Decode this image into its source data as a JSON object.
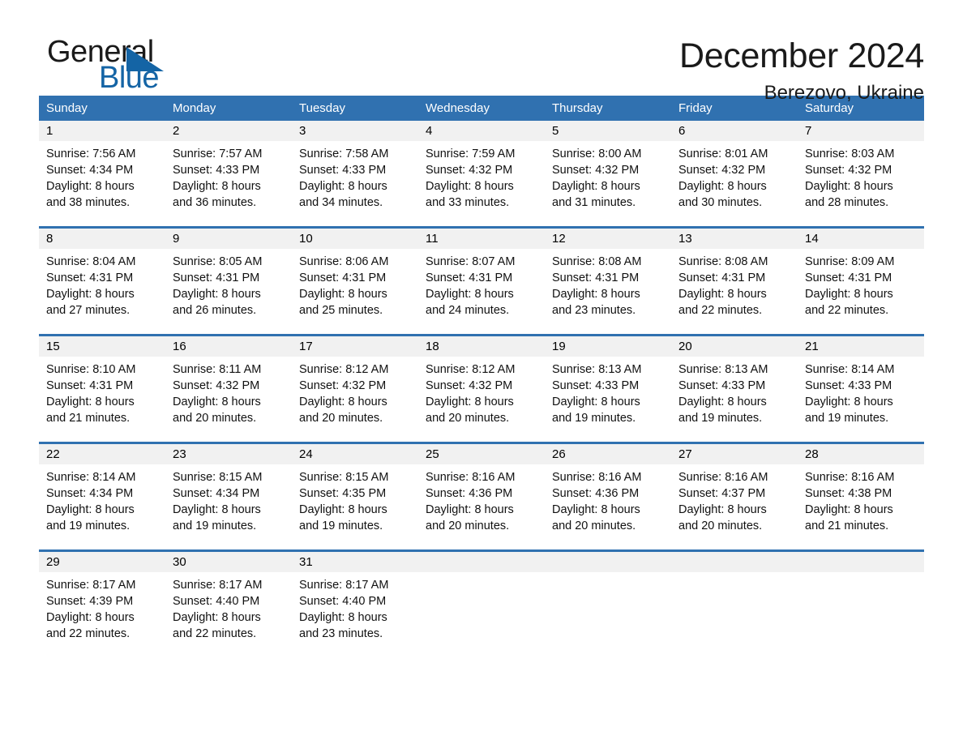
{
  "brand": {
    "name_part1": "General",
    "name_part2": "Blue",
    "triangle_color": "#1464a5",
    "text_color": "#1a1a1a"
  },
  "header": {
    "month_title": "December 2024",
    "location": "Berezovo, Ukraine"
  },
  "colors": {
    "header_blue": "#3071b0",
    "daynum_strip": "#f1f1f1",
    "page_background": "#ffffff"
  },
  "calendar": {
    "weekdays": [
      "Sunday",
      "Monday",
      "Tuesday",
      "Wednesday",
      "Thursday",
      "Friday",
      "Saturday"
    ],
    "weeks": [
      {
        "days": [
          {
            "num": "1",
            "lines": [
              "Sunrise: 7:56 AM",
              "Sunset: 4:34 PM",
              "Daylight: 8 hours",
              "and 38 minutes."
            ]
          },
          {
            "num": "2",
            "lines": [
              "Sunrise: 7:57 AM",
              "Sunset: 4:33 PM",
              "Daylight: 8 hours",
              "and 36 minutes."
            ]
          },
          {
            "num": "3",
            "lines": [
              "Sunrise: 7:58 AM",
              "Sunset: 4:33 PM",
              "Daylight: 8 hours",
              "and 34 minutes."
            ]
          },
          {
            "num": "4",
            "lines": [
              "Sunrise: 7:59 AM",
              "Sunset: 4:32 PM",
              "Daylight: 8 hours",
              "and 33 minutes."
            ]
          },
          {
            "num": "5",
            "lines": [
              "Sunrise: 8:00 AM",
              "Sunset: 4:32 PM",
              "Daylight: 8 hours",
              "and 31 minutes."
            ]
          },
          {
            "num": "6",
            "lines": [
              "Sunrise: 8:01 AM",
              "Sunset: 4:32 PM",
              "Daylight: 8 hours",
              "and 30 minutes."
            ]
          },
          {
            "num": "7",
            "lines": [
              "Sunrise: 8:03 AM",
              "Sunset: 4:32 PM",
              "Daylight: 8 hours",
              "and 28 minutes."
            ]
          }
        ]
      },
      {
        "days": [
          {
            "num": "8",
            "lines": [
              "Sunrise: 8:04 AM",
              "Sunset: 4:31 PM",
              "Daylight: 8 hours",
              "and 27 minutes."
            ]
          },
          {
            "num": "9",
            "lines": [
              "Sunrise: 8:05 AM",
              "Sunset: 4:31 PM",
              "Daylight: 8 hours",
              "and 26 minutes."
            ]
          },
          {
            "num": "10",
            "lines": [
              "Sunrise: 8:06 AM",
              "Sunset: 4:31 PM",
              "Daylight: 8 hours",
              "and 25 minutes."
            ]
          },
          {
            "num": "11",
            "lines": [
              "Sunrise: 8:07 AM",
              "Sunset: 4:31 PM",
              "Daylight: 8 hours",
              "and 24 minutes."
            ]
          },
          {
            "num": "12",
            "lines": [
              "Sunrise: 8:08 AM",
              "Sunset: 4:31 PM",
              "Daylight: 8 hours",
              "and 23 minutes."
            ]
          },
          {
            "num": "13",
            "lines": [
              "Sunrise: 8:08 AM",
              "Sunset: 4:31 PM",
              "Daylight: 8 hours",
              "and 22 minutes."
            ]
          },
          {
            "num": "14",
            "lines": [
              "Sunrise: 8:09 AM",
              "Sunset: 4:31 PM",
              "Daylight: 8 hours",
              "and 22 minutes."
            ]
          }
        ]
      },
      {
        "days": [
          {
            "num": "15",
            "lines": [
              "Sunrise: 8:10 AM",
              "Sunset: 4:31 PM",
              "Daylight: 8 hours",
              "and 21 minutes."
            ]
          },
          {
            "num": "16",
            "lines": [
              "Sunrise: 8:11 AM",
              "Sunset: 4:32 PM",
              "Daylight: 8 hours",
              "and 20 minutes."
            ]
          },
          {
            "num": "17",
            "lines": [
              "Sunrise: 8:12 AM",
              "Sunset: 4:32 PM",
              "Daylight: 8 hours",
              "and 20 minutes."
            ]
          },
          {
            "num": "18",
            "lines": [
              "Sunrise: 8:12 AM",
              "Sunset: 4:32 PM",
              "Daylight: 8 hours",
              "and 20 minutes."
            ]
          },
          {
            "num": "19",
            "lines": [
              "Sunrise: 8:13 AM",
              "Sunset: 4:33 PM",
              "Daylight: 8 hours",
              "and 19 minutes."
            ]
          },
          {
            "num": "20",
            "lines": [
              "Sunrise: 8:13 AM",
              "Sunset: 4:33 PM",
              "Daylight: 8 hours",
              "and 19 minutes."
            ]
          },
          {
            "num": "21",
            "lines": [
              "Sunrise: 8:14 AM",
              "Sunset: 4:33 PM",
              "Daylight: 8 hours",
              "and 19 minutes."
            ]
          }
        ]
      },
      {
        "days": [
          {
            "num": "22",
            "lines": [
              "Sunrise: 8:14 AM",
              "Sunset: 4:34 PM",
              "Daylight: 8 hours",
              "and 19 minutes."
            ]
          },
          {
            "num": "23",
            "lines": [
              "Sunrise: 8:15 AM",
              "Sunset: 4:34 PM",
              "Daylight: 8 hours",
              "and 19 minutes."
            ]
          },
          {
            "num": "24",
            "lines": [
              "Sunrise: 8:15 AM",
              "Sunset: 4:35 PM",
              "Daylight: 8 hours",
              "and 19 minutes."
            ]
          },
          {
            "num": "25",
            "lines": [
              "Sunrise: 8:16 AM",
              "Sunset: 4:36 PM",
              "Daylight: 8 hours",
              "and 20 minutes."
            ]
          },
          {
            "num": "26",
            "lines": [
              "Sunrise: 8:16 AM",
              "Sunset: 4:36 PM",
              "Daylight: 8 hours",
              "and 20 minutes."
            ]
          },
          {
            "num": "27",
            "lines": [
              "Sunrise: 8:16 AM",
              "Sunset: 4:37 PM",
              "Daylight: 8 hours",
              "and 20 minutes."
            ]
          },
          {
            "num": "28",
            "lines": [
              "Sunrise: 8:16 AM",
              "Sunset: 4:38 PM",
              "Daylight: 8 hours",
              "and 21 minutes."
            ]
          }
        ]
      },
      {
        "days": [
          {
            "num": "29",
            "lines": [
              "Sunrise: 8:17 AM",
              "Sunset: 4:39 PM",
              "Daylight: 8 hours",
              "and 22 minutes."
            ]
          },
          {
            "num": "30",
            "lines": [
              "Sunrise: 8:17 AM",
              "Sunset: 4:40 PM",
              "Daylight: 8 hours",
              "and 22 minutes."
            ]
          },
          {
            "num": "31",
            "lines": [
              "Sunrise: 8:17 AM",
              "Sunset: 4:40 PM",
              "Daylight: 8 hours",
              "and 23 minutes."
            ]
          },
          {
            "num": "",
            "lines": []
          },
          {
            "num": "",
            "lines": []
          },
          {
            "num": "",
            "lines": []
          },
          {
            "num": "",
            "lines": []
          }
        ]
      }
    ]
  }
}
